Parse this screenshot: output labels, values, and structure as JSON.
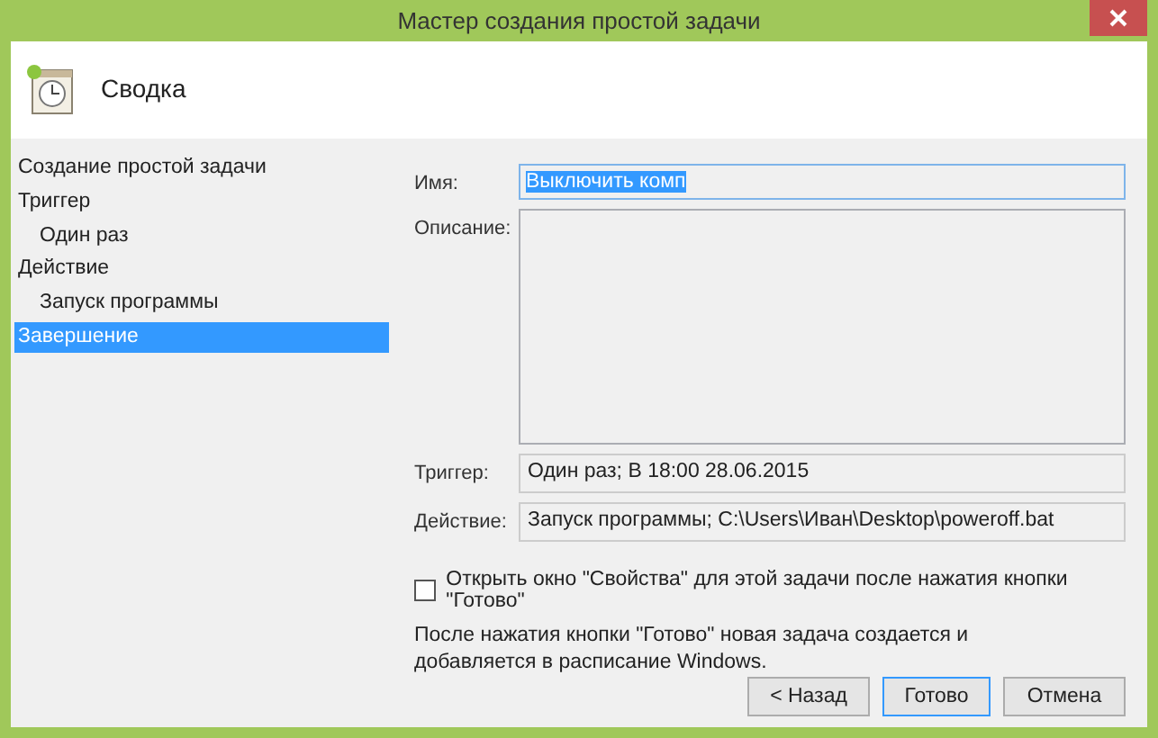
{
  "window": {
    "title": "Мастер создания простой задачи"
  },
  "header": {
    "title": "Сводка"
  },
  "steps": [
    {
      "label": "Создание простой задачи",
      "selected": false
    },
    {
      "label": "Триггер",
      "selected": false,
      "children": [
        {
          "label": "Один раз",
          "selected": false
        }
      ]
    },
    {
      "label": "Действие",
      "selected": false,
      "children": [
        {
          "label": "Запуск программы",
          "selected": false
        }
      ]
    },
    {
      "label": "Завершение",
      "selected": true
    }
  ],
  "name_field": {
    "label": "Имя:",
    "value": "Выключить комп",
    "text_selected": true
  },
  "description_field": {
    "label": "Описание:"
  },
  "summary": [
    {
      "label": "Триггер:",
      "value": "Один раз; В 18:00 28.06.2015"
    },
    {
      "label": "Действие:",
      "value": "Запуск программы; C:\\Users\\Иван\\Desktop\\poweroff.bat"
    }
  ],
  "open_properties": {
    "label": "Открыть окно \"Свойства\" для этой задачи после нажатия кнопки \"Готово\"",
    "checked": false
  },
  "note": "После нажатия кнопки \"Готово\" новая задача создается и добавляется в расписание Windows.",
  "buttons": [
    {
      "label": "< Назад",
      "default": false
    },
    {
      "label": "Готово",
      "default": true
    },
    {
      "label": "Отмена",
      "default": false
    }
  ]
}
